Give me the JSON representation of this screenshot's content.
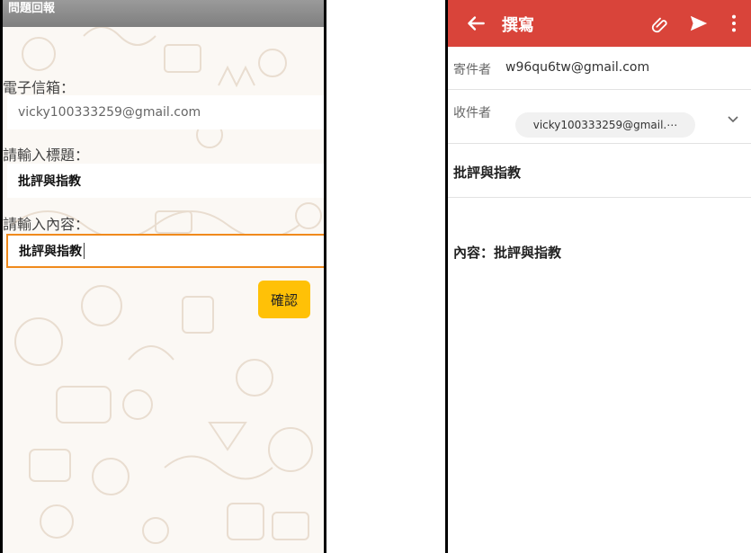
{
  "left_app": {
    "header_title": "問題回報",
    "email_label": "電子信箱：",
    "email_value": "vicky100333259@gmail.com",
    "title_label": "請輸入標題：",
    "title_value": "批評與指教",
    "content_label": "請輸入內容：",
    "content_value": "批評與指教",
    "confirm_button": "確認",
    "colors": {
      "header": "#8a8a8a",
      "focus_border": "#f08a1c",
      "button": "#ffc107"
    }
  },
  "right_app": {
    "toolbar": {
      "title": "撰寫",
      "back_icon": "arrow-left-icon",
      "attach_icon": "paperclip-icon",
      "send_icon": "send-icon",
      "more_icon": "more-vert-icon"
    },
    "from_label": "寄件者",
    "from_value": "w96qu6tw@gmail.com",
    "to_label": "收件者",
    "to_value": "vicky100333259@gmail.⋯",
    "subject": "批評與指教",
    "body": "內容：批評與指教",
    "colors": {
      "toolbar": "#d9443a"
    }
  }
}
